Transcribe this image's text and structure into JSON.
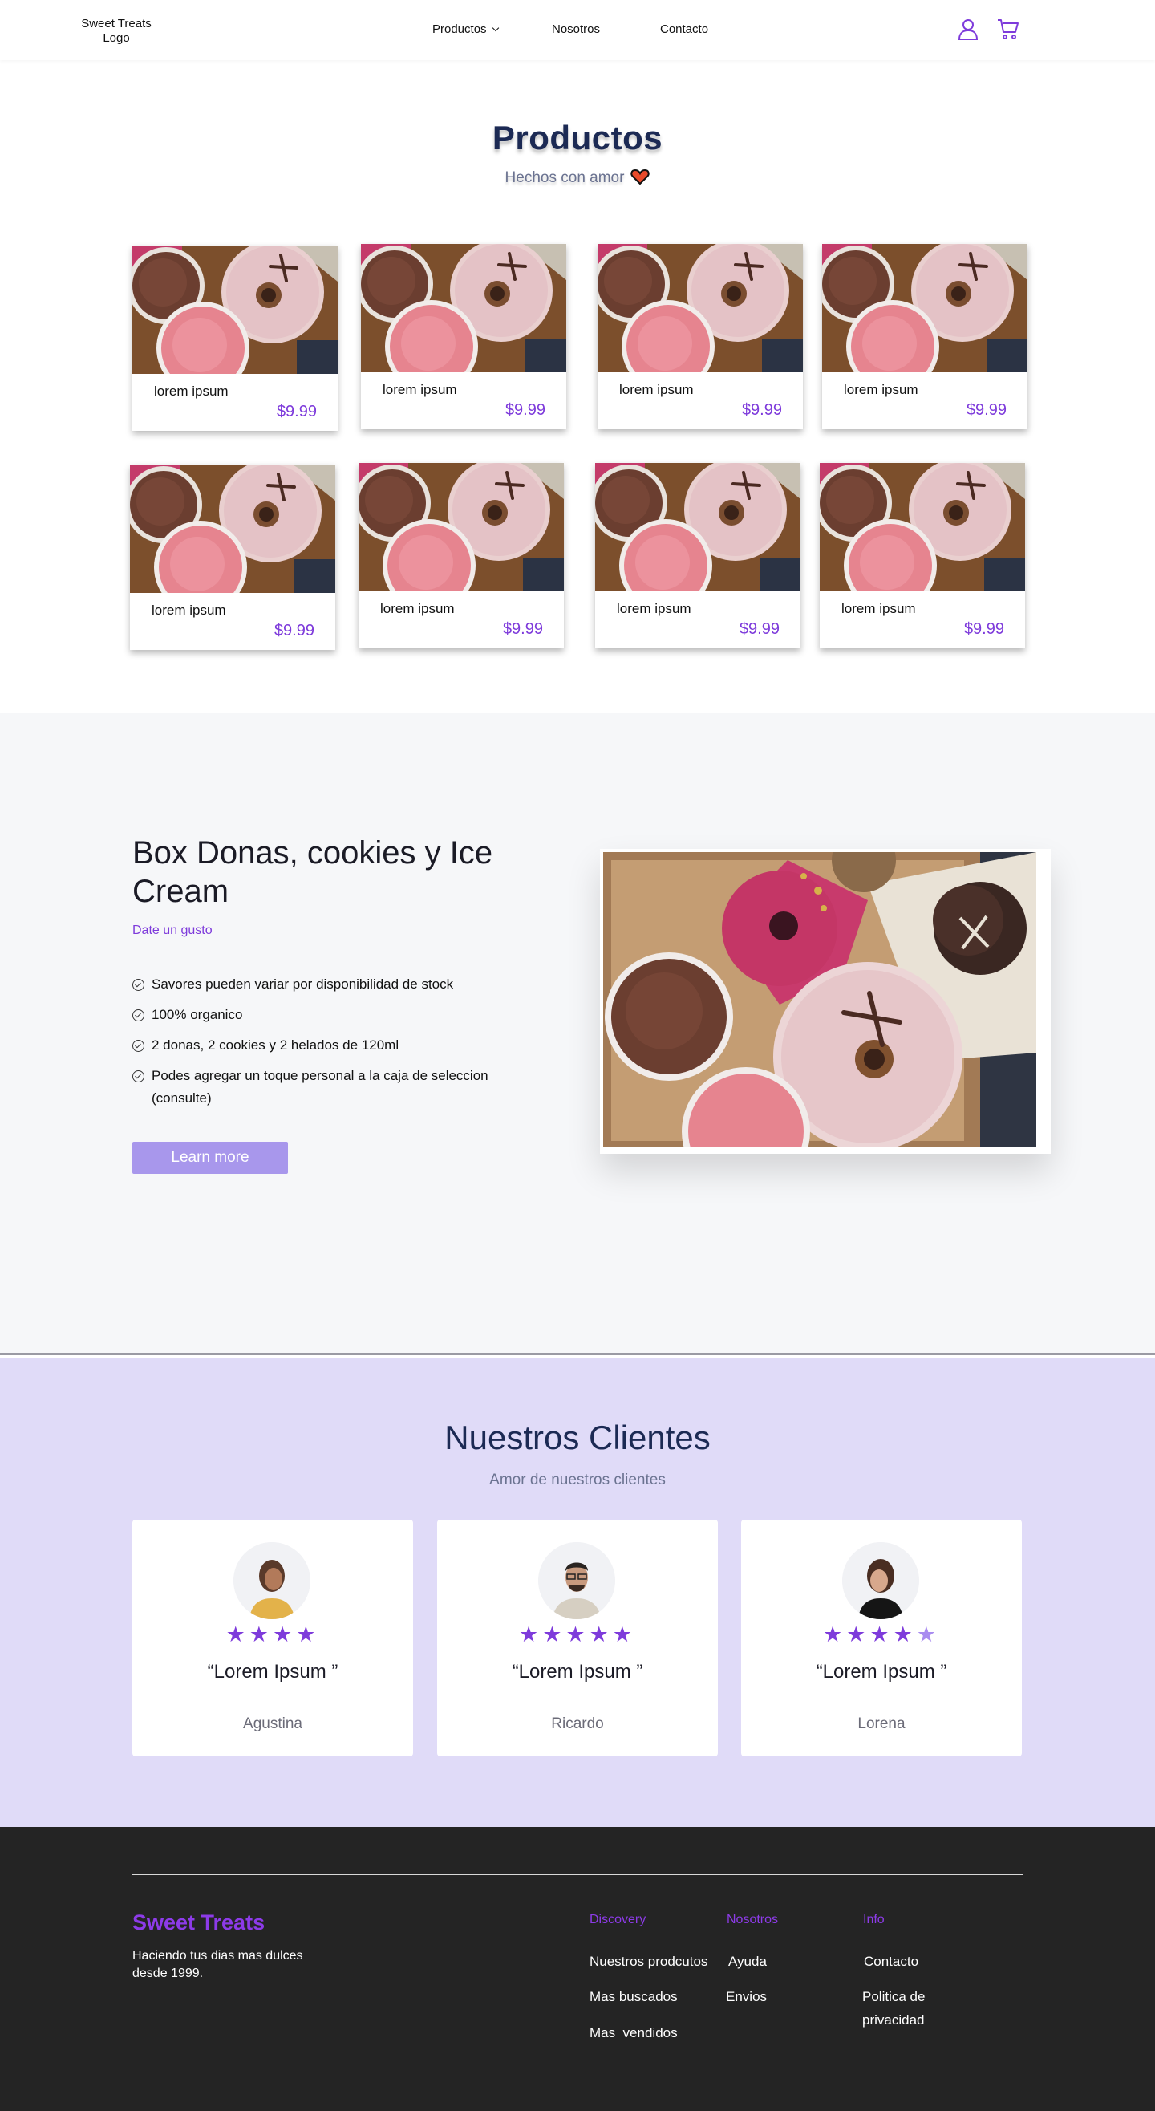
{
  "nav": {
    "logo": "Sweet Treats Logo",
    "links": [
      {
        "label": "Productos"
      },
      {
        "label": "Nosotros"
      },
      {
        "label": "Contacto"
      }
    ],
    "user_icon": "user-icon",
    "cart_icon": "cart-icon"
  },
  "products": {
    "title": "Productos",
    "subtitle": "Hechos con amor",
    "heart_icon": "heart-icon",
    "items": [
      {
        "name": "lorem ipsum",
        "price": "$9.99"
      },
      {
        "name": "lorem ipsum",
        "price": "$9.99"
      },
      {
        "name": "lorem ipsum",
        "price": "$9.99"
      },
      {
        "name": "lorem ipsum",
        "price": "$9.99"
      },
      {
        "name": "lorem ipsum",
        "price": "$9.99"
      },
      {
        "name": "lorem ipsum",
        "price": "$9.99"
      },
      {
        "name": "lorem ipsum",
        "price": "$9.99"
      },
      {
        "name": "lorem ipsum",
        "price": "$9.99"
      }
    ]
  },
  "box": {
    "title": "Box Donas, cookies y Ice Cream",
    "subtitle": "Date un gusto",
    "features": [
      "Savores pueden variar por disponibilidad de stock",
      "100% organico",
      "2 donas, 2 cookies y 2 helados de 120ml",
      "Podes agregar un toque personal a la caja de seleccion (consulte)"
    ],
    "button": "Learn more"
  },
  "clients": {
    "title": "Nuestros Clientes",
    "subtitle": "Amor de nuestros clientes",
    "items": [
      {
        "quote": "“Lorem Ipsum ”",
        "name": "Agustina",
        "stars": 4
      },
      {
        "quote": "“Lorem Ipsum ”",
        "name": "Ricardo",
        "stars": 5
      },
      {
        "quote": "“Lorem Ipsum ”",
        "name": "Lorena",
        "stars": 4.5
      }
    ]
  },
  "footer": {
    "brand": "Sweet Treats",
    "tagline": "Haciendo tus dias mas dulces desde 1999.",
    "columns": [
      {
        "heading": "Discovery",
        "links": [
          "Nuestros prodcutos",
          "Mas buscados",
          "Mas  vendidos"
        ]
      },
      {
        "heading": "Nosotros",
        "links": [
          "Ayuda",
          "Envios"
        ]
      },
      {
        "heading": "Info",
        "links": [
          "Contacto",
          "Politica de privacidad"
        ]
      }
    ]
  },
  "colors": {
    "accent": "#7e3bdb",
    "navy": "#1c2a54",
    "button": "#a897ec",
    "clients_bg": "#e0dbf8",
    "footer_bg": "#242424"
  }
}
